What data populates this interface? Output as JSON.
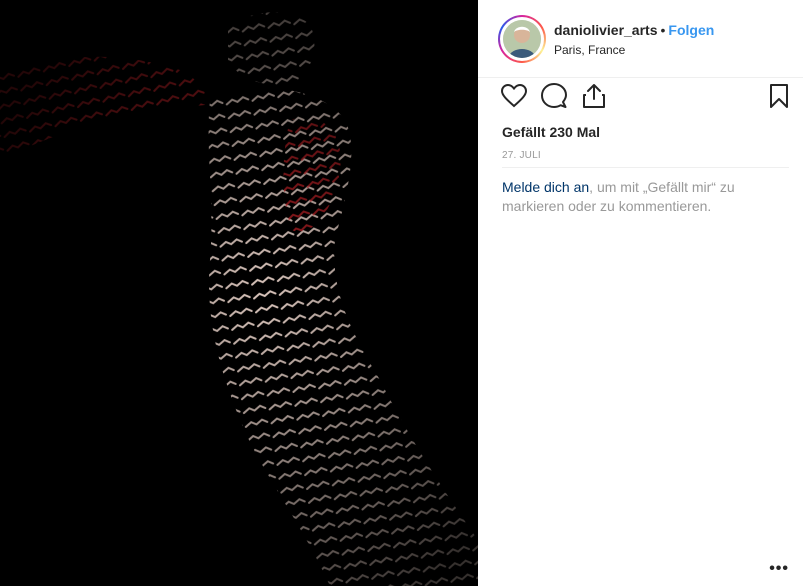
{
  "post": {
    "image_alt": "",
    "author": {
      "username": "daniolivier_arts",
      "separator": "•",
      "follow_label": "Folgen",
      "location": "Paris, France"
    },
    "actions": {
      "like_icon": "heart-icon",
      "comment_icon": "comment-icon",
      "share_icon": "share-icon",
      "save_icon": "bookmark-icon"
    },
    "likes_text": "Gefällt 230 Mal",
    "date": "27. JULI",
    "login_prompt": {
      "link": "Melde dich an",
      "rest": ", um mit „Gefällt mir“ zu markieren oder zu kommentieren."
    },
    "more_label": "•••"
  },
  "colors": {
    "follow": "#3897f0",
    "link": "#003569",
    "muted": "#999999",
    "text": "#262626",
    "photo_bg": "#000000"
  }
}
